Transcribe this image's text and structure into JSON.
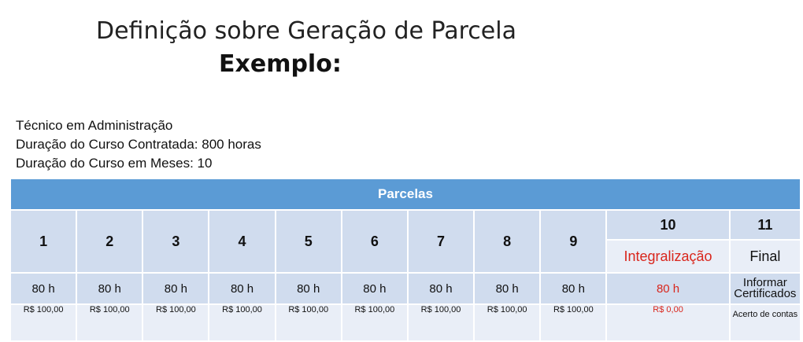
{
  "title": "Definição sobre Geração de Parcela",
  "subtitle": "Exemplo:",
  "info": [
    "Técnico em Administração",
    "Duração do Curso Contratada: 800 horas",
    "Duração do Curso em Meses: 10"
  ],
  "table": {
    "header": "Parcelas",
    "numbers": [
      "1",
      "2",
      "3",
      "4",
      "5",
      "6",
      "7",
      "8",
      "9",
      "10",
      "11"
    ],
    "labels": {
      "p10": "Integralização",
      "p11": "Final"
    },
    "hours": [
      "80 h",
      "80 h",
      "80 h",
      "80 h",
      "80 h",
      "80 h",
      "80 h",
      "80 h",
      "80 h",
      "80 h",
      "Informar Certificados"
    ],
    "values": [
      "R$ 100,00",
      "R$ 100,00",
      "R$ 100,00",
      "R$ 100,00",
      "R$ 100,00",
      "R$ 100,00",
      "R$ 100,00",
      "R$ 100,00",
      "R$ 100,00",
      "R$ 0,00",
      "Acerto de contas"
    ]
  },
  "colors": {
    "header_bg": "#5b9bd5",
    "cell_dark": "#d0dcee",
    "cell_light": "#e9eef7",
    "highlight": "#d9261c"
  }
}
